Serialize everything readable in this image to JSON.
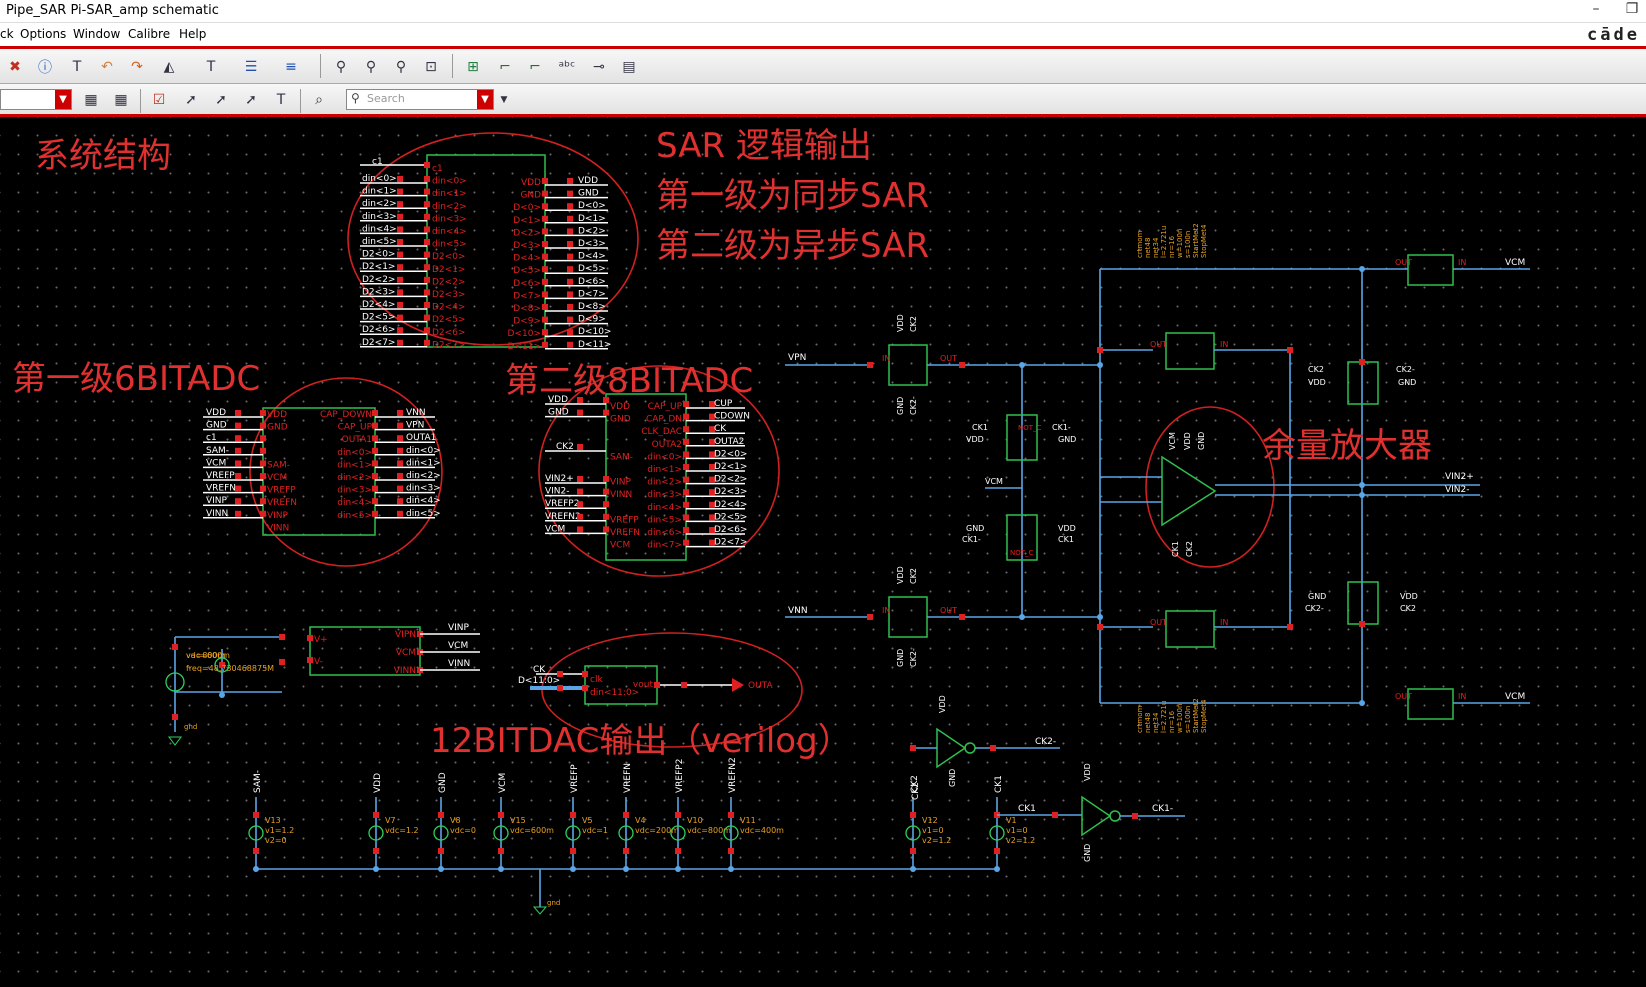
{
  "window": {
    "title": "Pipe_SAR Pi-SAR_amp schematic",
    "min_glyph": "–",
    "max_glyph": "❐"
  },
  "menu": {
    "items": [
      "ck",
      "Options",
      "Window",
      "Calibre",
      "Help"
    ],
    "brand": "cāde"
  },
  "toolbar": {
    "search_placeholder": "Search"
  },
  "notes": {
    "system": "系统结构",
    "sar_title": "SAR 逻辑输出",
    "sar_stage1": "第一级为同步SAR",
    "sar_stage2": "第二级为异步SAR",
    "stage1": "第一级6BITADC",
    "stage2": "第二级8BITADC",
    "residue": "余量放大器",
    "dac": "12BITDAC输出（verilog）"
  },
  "sar": {
    "top_label": "c1",
    "left_pins": [
      "din<0>",
      "din<1>",
      "din<2>",
      "din<3>",
      "din<4>",
      "din<5>",
      "D2<0>",
      "D2<1>",
      "D2<2>",
      "D2<3>",
      "D2<4>",
      "D2<5>",
      "D2<6>",
      "D2<7>"
    ],
    "inner_left": [
      "c1",
      "din<0>",
      "din<1>",
      "din<2>",
      "din<3>",
      "din<4>",
      "din<5>",
      "D2<0>",
      "D2<1>",
      "D2<2>",
      "D2<3>",
      "D2<4>",
      "D2<5>",
      "D2<6>",
      "D2<7>"
    ],
    "inner_right": [
      "VDD",
      "GND",
      "D<0>",
      "D<1>",
      "D<2>",
      "D<3>",
      "D<4>",
      "D<5>",
      "D<6>",
      "D<7>",
      "D<8>",
      "D<9>",
      "D<10>",
      "D<11>"
    ],
    "right_pins": [
      "VDD",
      "GND",
      "D<0>",
      "D<1>",
      "D<2>",
      "D<3>",
      "D<4>",
      "D<5>",
      "D<6>",
      "D<7>",
      "D<8>",
      "D<9>",
      "D<10>",
      "D<11>"
    ]
  },
  "adc1": {
    "left_pins": [
      "VDD",
      "GND",
      "c1",
      "SAM-",
      "VCM",
      "VREFP",
      "VREFN",
      "VINP",
      "VINN"
    ],
    "inner_left": [
      "VDD",
      "GND",
      "",
      "",
      "SAM-",
      "VCM",
      "VREFP",
      "VREFN",
      "VINP",
      "VINN"
    ],
    "inner_right": [
      "CAP_DOWN",
      "CAP_UP",
      "OUTA1",
      "din<0>",
      "din<1>",
      "din<2>",
      "din<3>",
      "din<4>",
      "din<5>"
    ],
    "right_pins": [
      "VNN",
      "VPN",
      "OUTA1",
      "din<0>",
      "din<1>",
      "din<2>",
      "din<3>",
      "din<4>",
      "din<5>"
    ]
  },
  "adc2": {
    "left_top": [
      "VDD",
      "GND"
    ],
    "left_mid": [
      "CK2"
    ],
    "left_bot": [
      "VIN2+",
      "VIN2-",
      "VREFP2",
      "VREFN2",
      "VCM"
    ],
    "inner_left": [
      "VDD",
      "GND",
      "",
      "",
      "SAM-",
      "",
      "VINP",
      "VINN",
      "",
      "VREFP",
      "VREFN",
      "VCM"
    ],
    "inner_right": [
      "CAP_UP",
      "CAP_DN",
      "CLK_DAC",
      "OUTA2",
      "din<0>",
      "din<1>",
      "din<2>",
      "din<3>",
      "din<4>",
      "din<5>",
      "din<6>",
      "din<7>"
    ],
    "right_pins": [
      "CUP",
      "CDOWN",
      "CK",
      "OUTA2",
      "D2<0>",
      "D2<1>",
      "D2<2>",
      "D2<3>",
      "D2<4>",
      "D2<5>",
      "D2<6>",
      "D2<7>"
    ]
  },
  "balun": {
    "inner_left": [
      "V+",
      "V-"
    ],
    "inner_right": [
      "VIPN",
      "VCM",
      "VINN"
    ],
    "out_labels": [
      "VINP",
      "VCM",
      "VINN"
    ],
    "src_labels": [
      "va=800m",
      "vdc=600m",
      "freq=48.730468875M"
    ],
    "gnd": "gnd"
  },
  "dac": {
    "in_ck": "CK",
    "in_bus": "D<11:0>",
    "clk": "clk",
    "din": "din<11:0>",
    "vout": "vout",
    "out": "OUTA"
  },
  "sources": [
    {
      "net": "SAM-",
      "name": "V13",
      "p1": "v1=1.2",
      "p2": "v2=0"
    },
    {
      "net": "VDD",
      "name": "V7",
      "p1": "vdc=1.2",
      "p2": ""
    },
    {
      "net": "GND",
      "name": "V8",
      "p1": "vdc=0",
      "p2": ""
    },
    {
      "net": "VCM",
      "name": "V15",
      "p1": "vdc=600m",
      "p2": ""
    },
    {
      "net": "VREFP",
      "name": "V5",
      "p1": "vdc=1",
      "p2": ""
    },
    {
      "net": "VREFN",
      "name": "V4",
      "p1": "vdc=200m",
      "p2": ""
    },
    {
      "net": "VREFP2",
      "name": "V10",
      "p1": "vdc=800m",
      "p2": ""
    },
    {
      "net": "VREFN2",
      "name": "V11",
      "p1": "vdc=400m",
      "p2": ""
    },
    {
      "net": "CK2",
      "name": "V12",
      "p1": "v1=0",
      "p2": "v2=1.2"
    },
    {
      "net": "CK1",
      "name": "V1",
      "p1": "v1=0",
      "p2": "v2=1.2"
    }
  ],
  "sources_gnd": "gnd",
  "inverters": [
    {
      "vdd": "VDD",
      "gnd": "GND",
      "in": "CK2",
      "out": "CK2-"
    },
    {
      "vdd": "VDD",
      "gnd": "GND",
      "in": "CK1",
      "out": "CK1-"
    }
  ],
  "front": {
    "vpn": "VPN",
    "vnn": "VNN",
    "sw_in": "IN",
    "sw_out": "OUT",
    "sw_notc": "NOT_C",
    "sw_c": "C",
    "vdd": "VDD",
    "gnd": "GND",
    "ck2": "CK2",
    "ck2b": "CK2-",
    "ck1": "CK1",
    "ck1b": "CK1-",
    "vcm": "VCM"
  },
  "amp": {
    "vcm": "VCM",
    "vdd": "VDD",
    "gnd": "GND",
    "ck1": "CK1",
    "ck2": "CK2",
    "vin2p": "VIN2+",
    "vin2n": "VIN2-",
    "vcm_out": "VCM",
    "cap_params": [
      "crtmom",
      "net48",
      "net34",
      "l=2.721u",
      "nr=16",
      "w=100n",
      "s=100n",
      "StartMet2",
      "StopMet4"
    ]
  },
  "colors": {
    "wire": "#5aa5e6",
    "pin": "#e02020",
    "symbol": "#2fbf4f",
    "text": "#e03030",
    "label": "#ffffff",
    "source": "#2fd05a",
    "param": "#e8a020"
  }
}
